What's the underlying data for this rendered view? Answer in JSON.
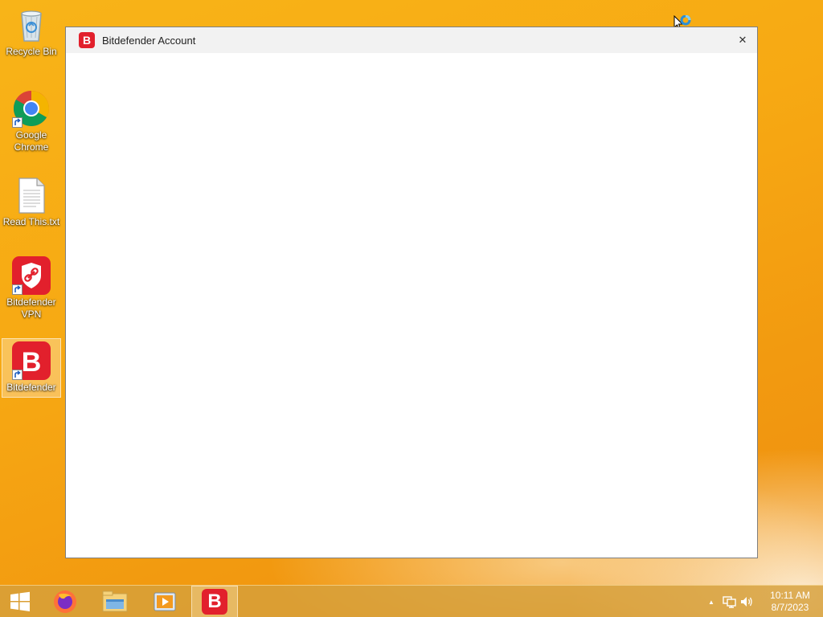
{
  "desktop": {
    "icons": [
      {
        "label": "Recycle Bin"
      },
      {
        "label": "Google Chrome"
      },
      {
        "label": "Read This.txt"
      },
      {
        "label": "Bitdefender VPN"
      },
      {
        "label": "Bitdefender"
      }
    ]
  },
  "window": {
    "title": "Bitdefender Account",
    "icon_letter": "B",
    "close_label": "✕"
  },
  "taskbar": {
    "items": [
      {
        "icon": "windows-start-icon"
      },
      {
        "icon": "firefox-icon"
      },
      {
        "icon": "file-explorer-icon"
      },
      {
        "icon": "media-player-icon"
      },
      {
        "icon": "bitdefender-icon",
        "letter": "B",
        "active": true
      }
    ],
    "tray": {
      "chevron": "▲",
      "time": "10:11 AM",
      "date": "8/7/2023"
    }
  },
  "colors": {
    "brand_red": "#e2202c",
    "desktop_orange": "#f7a913"
  }
}
